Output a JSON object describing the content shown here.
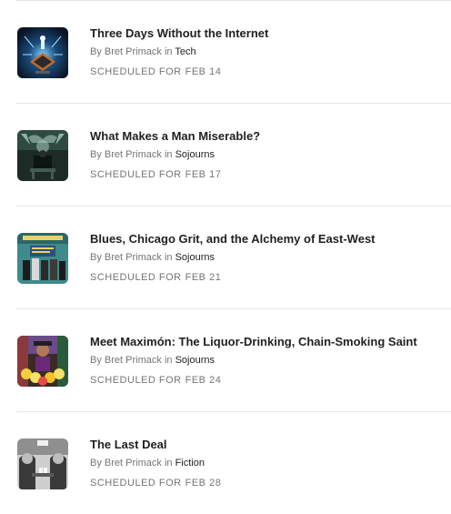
{
  "byline": {
    "prefix": "By",
    "author": "Bret Primack",
    "in_word": "in"
  },
  "schedule_prefix": "SCHEDULED FOR",
  "posts": [
    {
      "title": "Three Days Without the Internet",
      "section": "Tech",
      "date": "FEB 14",
      "thumb_icon": "tech-circuit-thumbnail"
    },
    {
      "title": "What Makes a Man Miserable?",
      "section": "Sojourns",
      "date": "FEB 17",
      "thumb_icon": "seated-man-thumbnail"
    },
    {
      "title": "Blues, Chicago Grit, and the Alchemy of East-West",
      "section": "Sojourns",
      "date": "FEB 21",
      "thumb_icon": "album-cover-thumbnail"
    },
    {
      "title": "Meet Maximón: The Liquor-Drinking, Chain-Smoking Saint",
      "section": "Sojourns",
      "date": "FEB 24",
      "thumb_icon": "maximon-flowers-thumbnail"
    },
    {
      "title": "The Last Deal",
      "section": "Fiction",
      "date": "FEB 28",
      "thumb_icon": "card-players-thumbnail"
    }
  ]
}
